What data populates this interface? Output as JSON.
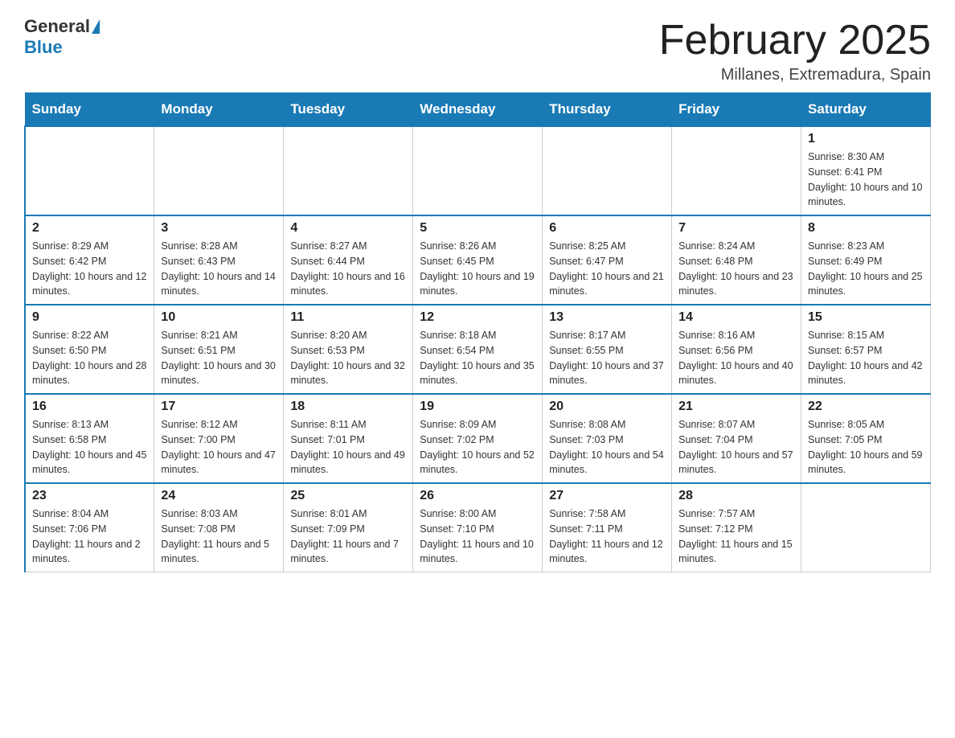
{
  "header": {
    "logo_general": "General",
    "logo_blue": "Blue",
    "month_title": "February 2025",
    "location": "Millanes, Extremadura, Spain"
  },
  "days_of_week": [
    "Sunday",
    "Monday",
    "Tuesday",
    "Wednesday",
    "Thursday",
    "Friday",
    "Saturday"
  ],
  "weeks": [
    [
      {
        "day": "",
        "info": ""
      },
      {
        "day": "",
        "info": ""
      },
      {
        "day": "",
        "info": ""
      },
      {
        "day": "",
        "info": ""
      },
      {
        "day": "",
        "info": ""
      },
      {
        "day": "",
        "info": ""
      },
      {
        "day": "1",
        "info": "Sunrise: 8:30 AM\nSunset: 6:41 PM\nDaylight: 10 hours and 10 minutes."
      }
    ],
    [
      {
        "day": "2",
        "info": "Sunrise: 8:29 AM\nSunset: 6:42 PM\nDaylight: 10 hours and 12 minutes."
      },
      {
        "day": "3",
        "info": "Sunrise: 8:28 AM\nSunset: 6:43 PM\nDaylight: 10 hours and 14 minutes."
      },
      {
        "day": "4",
        "info": "Sunrise: 8:27 AM\nSunset: 6:44 PM\nDaylight: 10 hours and 16 minutes."
      },
      {
        "day": "5",
        "info": "Sunrise: 8:26 AM\nSunset: 6:45 PM\nDaylight: 10 hours and 19 minutes."
      },
      {
        "day": "6",
        "info": "Sunrise: 8:25 AM\nSunset: 6:47 PM\nDaylight: 10 hours and 21 minutes."
      },
      {
        "day": "7",
        "info": "Sunrise: 8:24 AM\nSunset: 6:48 PM\nDaylight: 10 hours and 23 minutes."
      },
      {
        "day": "8",
        "info": "Sunrise: 8:23 AM\nSunset: 6:49 PM\nDaylight: 10 hours and 25 minutes."
      }
    ],
    [
      {
        "day": "9",
        "info": "Sunrise: 8:22 AM\nSunset: 6:50 PM\nDaylight: 10 hours and 28 minutes."
      },
      {
        "day": "10",
        "info": "Sunrise: 8:21 AM\nSunset: 6:51 PM\nDaylight: 10 hours and 30 minutes."
      },
      {
        "day": "11",
        "info": "Sunrise: 8:20 AM\nSunset: 6:53 PM\nDaylight: 10 hours and 32 minutes."
      },
      {
        "day": "12",
        "info": "Sunrise: 8:18 AM\nSunset: 6:54 PM\nDaylight: 10 hours and 35 minutes."
      },
      {
        "day": "13",
        "info": "Sunrise: 8:17 AM\nSunset: 6:55 PM\nDaylight: 10 hours and 37 minutes."
      },
      {
        "day": "14",
        "info": "Sunrise: 8:16 AM\nSunset: 6:56 PM\nDaylight: 10 hours and 40 minutes."
      },
      {
        "day": "15",
        "info": "Sunrise: 8:15 AM\nSunset: 6:57 PM\nDaylight: 10 hours and 42 minutes."
      }
    ],
    [
      {
        "day": "16",
        "info": "Sunrise: 8:13 AM\nSunset: 6:58 PM\nDaylight: 10 hours and 45 minutes."
      },
      {
        "day": "17",
        "info": "Sunrise: 8:12 AM\nSunset: 7:00 PM\nDaylight: 10 hours and 47 minutes."
      },
      {
        "day": "18",
        "info": "Sunrise: 8:11 AM\nSunset: 7:01 PM\nDaylight: 10 hours and 49 minutes."
      },
      {
        "day": "19",
        "info": "Sunrise: 8:09 AM\nSunset: 7:02 PM\nDaylight: 10 hours and 52 minutes."
      },
      {
        "day": "20",
        "info": "Sunrise: 8:08 AM\nSunset: 7:03 PM\nDaylight: 10 hours and 54 minutes."
      },
      {
        "day": "21",
        "info": "Sunrise: 8:07 AM\nSunset: 7:04 PM\nDaylight: 10 hours and 57 minutes."
      },
      {
        "day": "22",
        "info": "Sunrise: 8:05 AM\nSunset: 7:05 PM\nDaylight: 10 hours and 59 minutes."
      }
    ],
    [
      {
        "day": "23",
        "info": "Sunrise: 8:04 AM\nSunset: 7:06 PM\nDaylight: 11 hours and 2 minutes."
      },
      {
        "day": "24",
        "info": "Sunrise: 8:03 AM\nSunset: 7:08 PM\nDaylight: 11 hours and 5 minutes."
      },
      {
        "day": "25",
        "info": "Sunrise: 8:01 AM\nSunset: 7:09 PM\nDaylight: 11 hours and 7 minutes."
      },
      {
        "day": "26",
        "info": "Sunrise: 8:00 AM\nSunset: 7:10 PM\nDaylight: 11 hours and 10 minutes."
      },
      {
        "day": "27",
        "info": "Sunrise: 7:58 AM\nSunset: 7:11 PM\nDaylight: 11 hours and 12 minutes."
      },
      {
        "day": "28",
        "info": "Sunrise: 7:57 AM\nSunset: 7:12 PM\nDaylight: 11 hours and 15 minutes."
      },
      {
        "day": "",
        "info": ""
      }
    ]
  ]
}
